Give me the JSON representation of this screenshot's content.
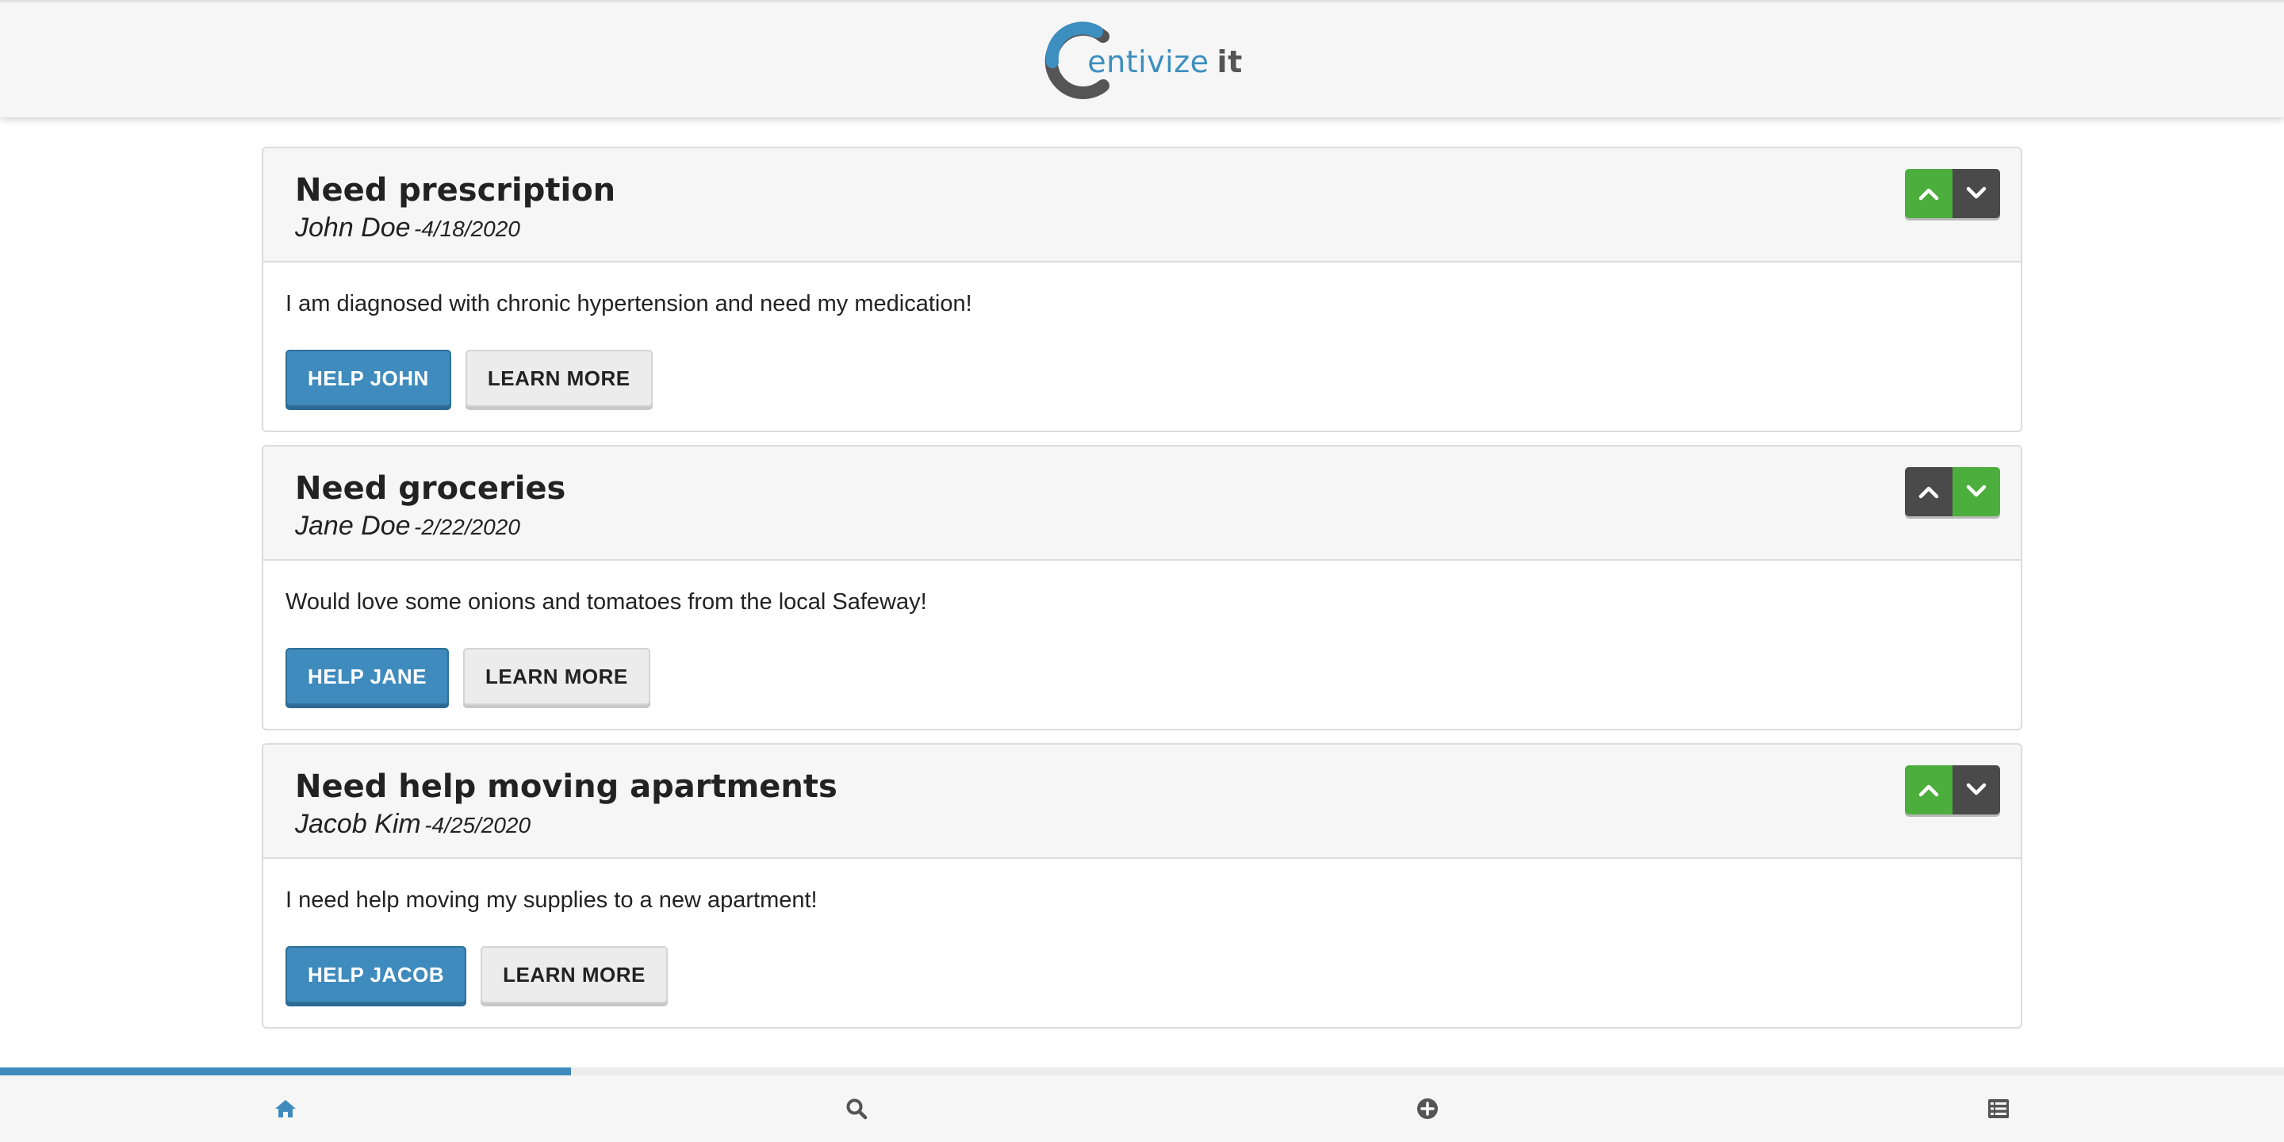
{
  "header": {
    "logo_brand": "entivize",
    "logo_suffix": "it"
  },
  "posts": [
    {
      "title": "Need prescription",
      "author": "John Doe",
      "date": "-4/18/2020",
      "description": "I am diagnosed with chronic hypertension and need my medication!",
      "help_label": "HELP JOHN",
      "learn_label": "LEARN MORE",
      "vote_state": "up"
    },
    {
      "title": "Need groceries",
      "author": "Jane Doe",
      "date": "-2/22/2020",
      "description": "Would love some onions and tomatoes from the local Safeway!",
      "help_label": "HELP JANE",
      "learn_label": "LEARN MORE",
      "vote_state": "down"
    },
    {
      "title": "Need help moving apartments",
      "author": "Jacob Kim",
      "date": "-4/25/2020",
      "description": "I need help moving my supplies to a new apartment!",
      "help_label": "HELP JACOB",
      "learn_label": "LEARN MORE",
      "vote_state": "up"
    }
  ],
  "bottom_nav": {
    "progress_fraction": 0.25,
    "items": [
      {
        "icon": "home-icon",
        "active": true
      },
      {
        "icon": "search-icon",
        "active": false
      },
      {
        "icon": "plus-circle-icon",
        "active": false
      },
      {
        "icon": "list-icon",
        "active": false
      }
    ]
  },
  "colors": {
    "accent": "#3f8bbd",
    "vote_active": "#4cae3c",
    "vote_inactive": "#4a4a4a",
    "nav_active": "#3f8bbd",
    "nav_inactive": "#555555"
  }
}
